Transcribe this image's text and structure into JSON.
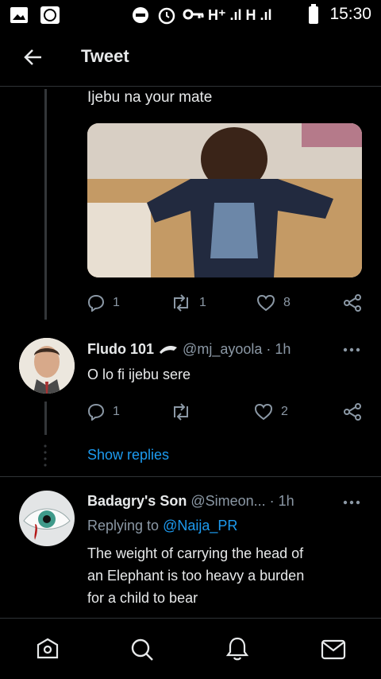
{
  "status": {
    "time": "15:30",
    "network": "H⁺ .ıl H .ıl"
  },
  "header": {
    "title": "Tweet"
  },
  "tweet1": {
    "text": "Ijebu na your mate",
    "reply_count": "1",
    "retweet_count": "1",
    "like_count": "8"
  },
  "reply1": {
    "name": "Fludo 101",
    "handle": "@mj_ayoola",
    "time": "· 1h",
    "text": "O lo fi ijebu sere",
    "reply_count": "1",
    "like_count": "2"
  },
  "show_replies": "Show replies",
  "reply2": {
    "name": "Badagry's Son",
    "handle": "@Simeon...",
    "time": "· 1h",
    "replying_prefix": "Replying to",
    "replying_to": "@Naija_PR",
    "text_line1": "The weight of carrying the head of",
    "text_line2": "an Elephant is too heavy a burden",
    "text_line3": "for a child to bear"
  },
  "icons": [
    "image-icon",
    "whatsapp-icon",
    "dnd-icon",
    "alarm-icon",
    "key-icon",
    "battery-icon",
    "back-arrow-icon",
    "reply-icon",
    "retweet-icon",
    "like-icon",
    "share-icon",
    "more-icon",
    "home-icon",
    "search-icon",
    "notifications-icon",
    "messages-icon"
  ],
  "colors": {
    "background": "#000000",
    "link": "#1d9bf0",
    "muted": "#8b98a5"
  }
}
